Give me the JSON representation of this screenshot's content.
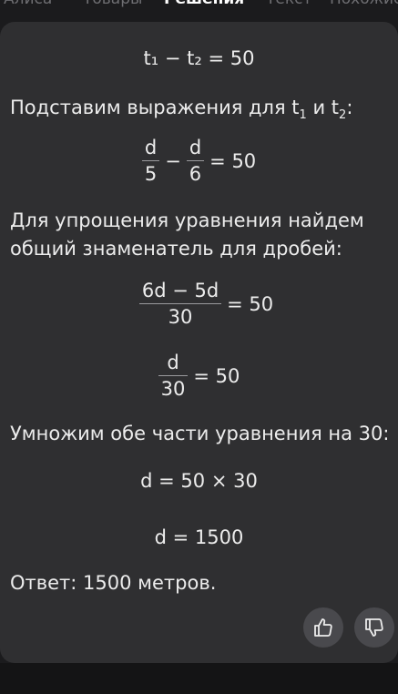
{
  "tabs": [
    "Алиса",
    "Товары",
    "Решения",
    "Текст",
    "Похожие"
  ],
  "lines": {
    "eq1": "t₁ − t₂ = 50",
    "text1_part1": "Подставим выражения для t",
    "text1_sub1": "1",
    "text1_and": " и t",
    "text1_sub2": "2",
    "text1_colon": ":",
    "eq2_num1": "d",
    "eq2_den1": "5",
    "eq2_minus": "−",
    "eq2_num2": "d",
    "eq2_den2": "6",
    "eq2_rhs": "= 50",
    "text2": "Для упрощения уравнения найдем общий знаменатель для дробей:",
    "eq3_num": "6d − 5d",
    "eq3_den": "30",
    "eq3_rhs": "= 50",
    "eq4_num": "d",
    "eq4_den": "30",
    "eq4_rhs": "= 50",
    "text3": "Умножим обе части уравнения на 30:",
    "eq5": "d = 50 × 30",
    "eq6": "d = 1500",
    "answer": "Ответ: 1500 метров."
  },
  "feedback": {
    "like_icon": "thumbs-up-icon",
    "dislike_icon": "thumbs-down-icon"
  },
  "colors": {
    "background": "#1b1b1d",
    "card": "#2f2f31",
    "text": "#ececec",
    "tab_inactive": "#6e6e72",
    "button": "#49494d"
  }
}
